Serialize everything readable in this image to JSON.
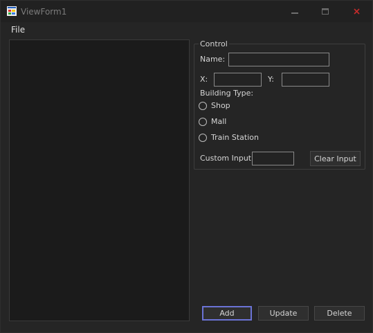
{
  "window": {
    "title": "ViewForm1",
    "close_color": "#c42b2b"
  },
  "menu": {
    "file_label": "File"
  },
  "control_group": {
    "legend": "Control",
    "name_label": "Name:",
    "name_value": "",
    "x_label": "X:",
    "x_value": "",
    "y_label": "Y:",
    "y_value": "",
    "building_type_label": "Building Type:",
    "building_types": [
      "Shop",
      "Mall",
      "Train Station"
    ],
    "selected_building_type": null,
    "custom_input_label": "Custom Input:",
    "custom_input_value": "",
    "clear_input_label": "Clear Input"
  },
  "actions": {
    "add_label": "Add",
    "update_label": "Update",
    "delete_label": "Delete",
    "accent_color": "#6b73d6"
  },
  "list": {
    "items": []
  }
}
